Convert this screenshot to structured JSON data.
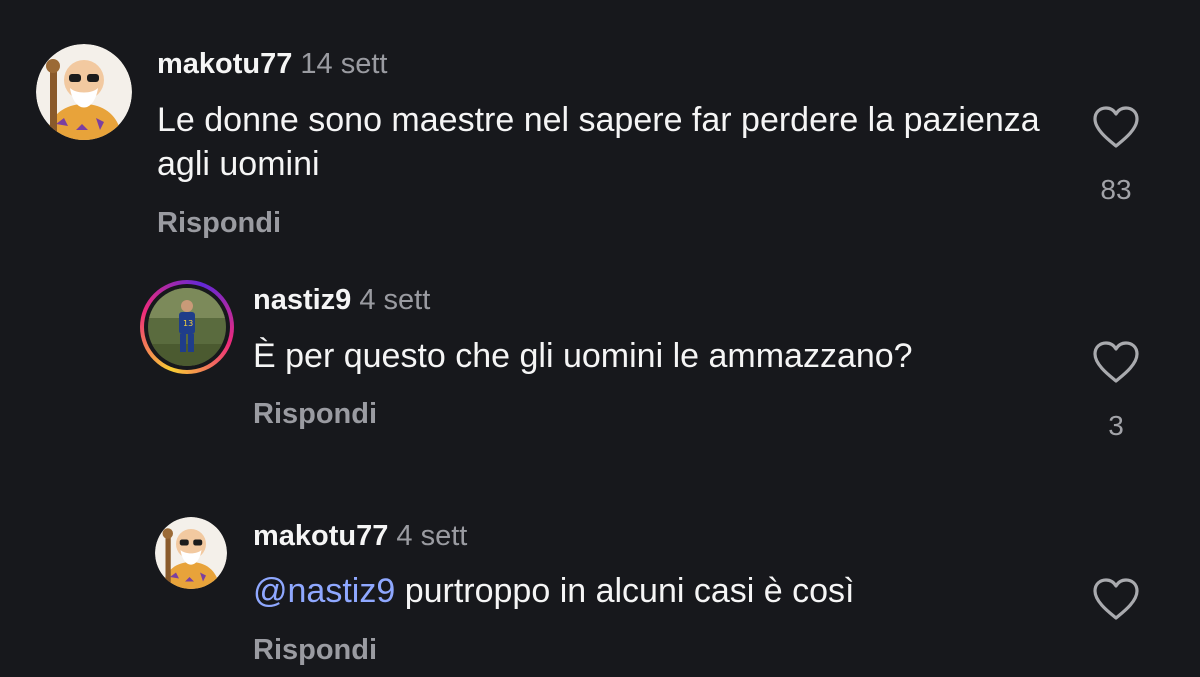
{
  "comments": [
    {
      "username": "makotu77",
      "time": "14 sett",
      "text": "Le donne sono maestre nel sapere far perdere la pazienza agli uomini",
      "reply_label": "Rispondi",
      "likes": "83",
      "avatar_icon": "roshi-avatar"
    },
    {
      "username": "nastiz9",
      "time": "4 sett",
      "text": "È per questo che gli uomini le ammazzano?",
      "reply_label": "Rispondi",
      "likes": "3",
      "avatar_icon": "football-player-avatar"
    },
    {
      "username": "makotu77",
      "time": "4 sett",
      "mention": "@nastiz9",
      "text": " purtroppo in alcuni casi è così",
      "reply_label": "Rispondi",
      "likes": "",
      "avatar_icon": "roshi-avatar"
    }
  ],
  "colors": {
    "background": "#17181c",
    "mention": "#8fa8ff",
    "muted": "#9a9ba1"
  }
}
